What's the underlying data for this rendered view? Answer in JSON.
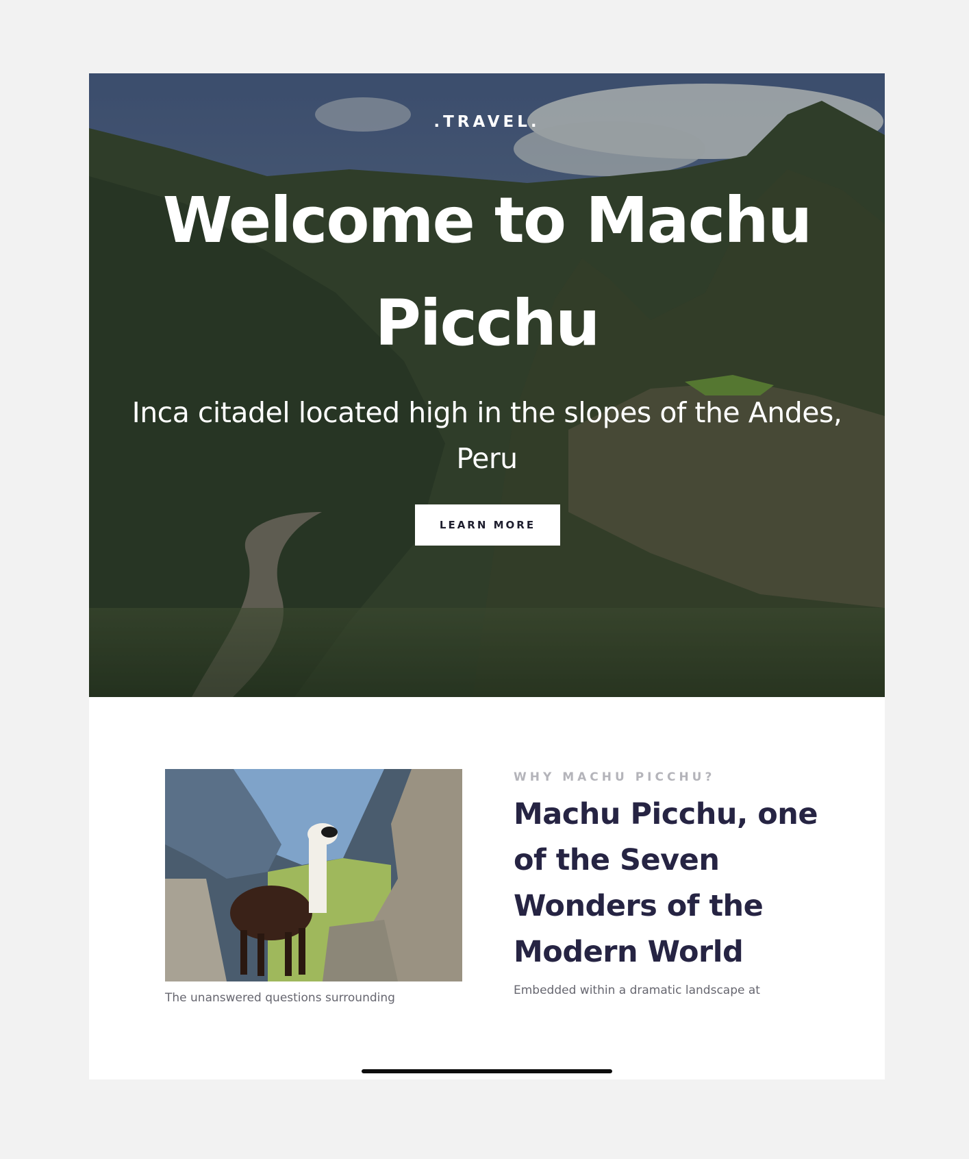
{
  "hero": {
    "brand": ".TRAVEL.",
    "title": "Welcome to Machu Picchu",
    "subtitle": "Inca citadel located high in the slopes of the Andes, Peru",
    "cta_label": "LEARN MORE"
  },
  "about": {
    "eyebrow": "WHY MACHU PICCHU?",
    "title": "Machu Picchu, one of the Seven Wonders of the Modern World",
    "body": "Embedded within a dramatic landscape at",
    "caption": "The unanswered questions surrounding"
  },
  "colors": {
    "page_background": "#f2f2f2",
    "heading": "#262443",
    "eyebrow": "#b4b4ba",
    "body_text": "#66666f",
    "button_bg": "#ffffff"
  }
}
